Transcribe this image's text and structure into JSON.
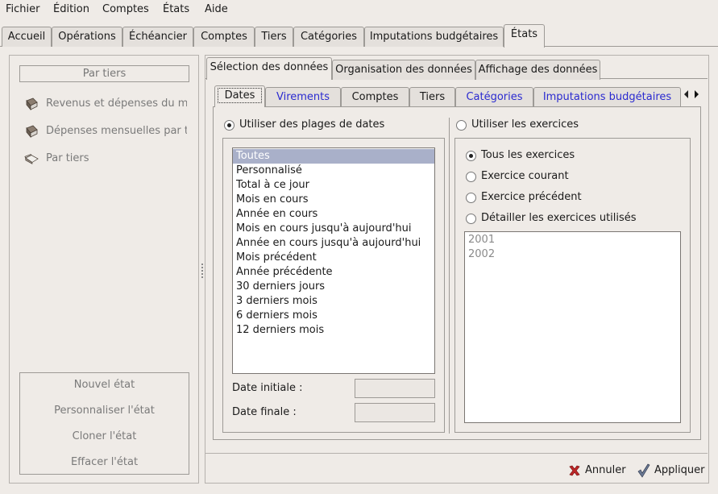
{
  "menu": [
    "Fichier",
    "Édition",
    "Comptes",
    "États",
    "Aide"
  ],
  "main_tabs": [
    "Accueil",
    "Opérations",
    "Échéancier",
    "Comptes",
    "Tiers",
    "Catégories",
    "Imputations budgétaires",
    "États"
  ],
  "left_panel": {
    "header": "Par tiers",
    "reports": [
      "Revenus et dépenses du m",
      "Dépenses mensuelles par t",
      "Par tiers"
    ],
    "buttons": [
      "Nouvel état",
      "Personnaliser l'état",
      "Cloner l'état",
      "Effacer l'état"
    ]
  },
  "sub_tabs": [
    "Sélection des données",
    "Organisation des données",
    "Affichage des données"
  ],
  "inner_tabs": [
    "Dates",
    "Virements",
    "Comptes",
    "Tiers",
    "Catégories",
    "Imputations budgétaires"
  ],
  "dates": {
    "use_ranges_label": "Utiliser des plages de dates",
    "ranges": [
      "Toutes",
      "Personnalisé",
      "Total à ce jour",
      "Mois en cours",
      "Année en cours",
      "Mois en cours jusqu'à aujourd'hui",
      "Année en cours jusqu'à aujourd'hui",
      "Mois précédent",
      "Année précédente",
      "30 derniers jours",
      "3 derniers mois",
      "6 derniers mois",
      "12 derniers mois"
    ],
    "selected_range": "Toutes",
    "date_initiale_label": "Date initiale :",
    "date_finale_label": "Date finale :",
    "date_initiale_value": "",
    "date_finale_value": ""
  },
  "exercices": {
    "use_exercices_label": "Utiliser les exercices",
    "options": [
      "Tous les exercices",
      "Exercice courant",
      "Exercice précédent",
      "Détailler les exercices utilisés"
    ],
    "selected_option": "Tous les exercices",
    "years": [
      "2001",
      "2002"
    ]
  },
  "actions": {
    "cancel": "Annuler",
    "apply": "Appliquer"
  },
  "colors": {
    "window_bg": "#efebe7",
    "selection": "#a9b0c9",
    "link_blue": "#2a2ad0",
    "cancel_red": "#c0282a",
    "apply_check": "#4a5a7a"
  },
  "icons": {
    "report": "book-icon",
    "report_open": "open-book-icon",
    "cancel": "red-x-icon",
    "apply": "checkmark-icon",
    "scroll_left": "left-arrow-icon",
    "scroll_right": "right-arrow-icon"
  }
}
